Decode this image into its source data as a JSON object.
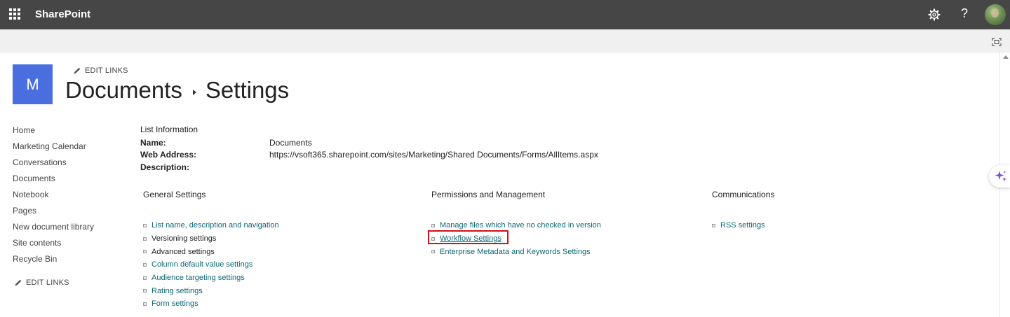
{
  "suitebar": {
    "brand": "SharePoint",
    "icons": [
      "app-launcher-icon",
      "gear-icon",
      "help-icon",
      "avatar"
    ],
    "help_glyph": "?",
    "background": "#464646"
  },
  "site": {
    "logo_letter": "M",
    "logo_color": "#4a6ee0",
    "edit_links": "EDIT LINKS",
    "breadcrumb": [
      "Documents",
      "Settings"
    ]
  },
  "quick_launch": {
    "items": [
      "Home",
      "Marketing Calendar",
      "Conversations",
      "Documents",
      "Notebook",
      "Pages",
      "New document library",
      "Site contents",
      "Recycle Bin"
    ],
    "edit_links": "EDIT LINKS"
  },
  "list_info": {
    "heading": "List Information",
    "name_label": "Name:",
    "name_value": "Documents",
    "web_address_label": "Web Address:",
    "web_address_value": "https://vsoft365.sharepoint.com/sites/Marketing/Shared Documents/Forms/AllItems.aspx",
    "description_label": "Description:"
  },
  "sections": {
    "general": {
      "heading": "General Settings",
      "links": [
        "List name, description and navigation",
        "Versioning settings",
        "Advanced settings",
        "Column default value settings",
        "Audience targeting settings",
        "Rating settings",
        "Form settings"
      ]
    },
    "permissions": {
      "heading": "Permissions and Management",
      "links": [
        "Manage files which have no checked in version",
        "Workflow Settings",
        "Enterprise Metadata and Keywords Settings"
      ]
    },
    "communications": {
      "heading": "Communications",
      "links": [
        "RSS settings"
      ]
    }
  },
  "colors": {
    "link": "#0c6674",
    "highlight": "#d0101b"
  }
}
